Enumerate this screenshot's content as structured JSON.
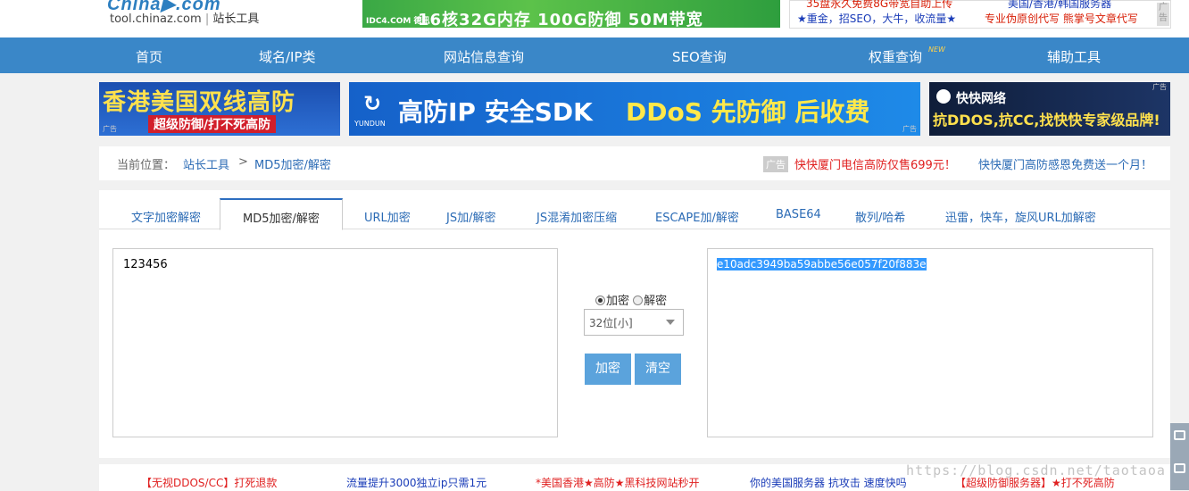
{
  "header": {
    "logo_text": "China▶.com",
    "site_url": "tool.chinaz.com",
    "site_name": "站长工具",
    "banner_brand": "IDC4.COM 德讯",
    "banner_text": "16核32G内存 100G防御 50M带宽",
    "ad_links": [
      "35盘永久免费8G带宽自助上传",
      "美国/香港/韩国服务器",
      "★重金，招SEO，大牛，收流量★",
      "专业伪原创代写 熊掌号文章代写"
    ],
    "ad_tag": "广告"
  },
  "nav": {
    "items": [
      "首页",
      "域名/IP类",
      "网站信息查询",
      "SEO查询",
      "权重查询",
      "辅助工具"
    ],
    "new_badge": "NEW"
  },
  "ads": {
    "left_title": "香港美国双线高防",
    "left_sub": "超级防御/打不死高防",
    "center_logo": "YUNDUN",
    "center_text1": "高防IP 安全SDK",
    "center_text2": "DDoS 先防御 后收费",
    "right_brand": "快快网络",
    "right_text": "抗DDOS,抗CC,找快快专家级品牌!",
    "ad_mark": "广告"
  },
  "breadcrumb": {
    "prefix": "当前位置：",
    "home": "站长工具",
    "sep": ">",
    "current": "MD5加密/解密",
    "ad_tag": "广告",
    "promo1": "快快厦门电信高防仅售699元！",
    "promo2": "快快厦门高防感恩免费送一个月！"
  },
  "tabs": [
    "文字加密解密",
    "MD5加密/解密",
    "URL加密",
    "JS加/解密",
    "JS混淆加密压缩",
    "ESCAPE加/解密",
    "BASE64",
    "散列/哈希",
    "迅雷，快车，旋风URL加解密"
  ],
  "tool": {
    "input_value": "123456",
    "output_value": "e10adc3949ba59abbe56e057f20f883e",
    "radio_encrypt": "加密",
    "radio_decrypt": "解密",
    "mode_selected": "32位[小]",
    "encrypt_button": "加密",
    "clear_button": "清空"
  },
  "footer_links": [
    "【无视DDOS/CC】打死退款",
    "流量提升3000独立ip只需1元",
    "*美国香港★高防★黑科技网站秒开",
    "你的美国服务器 抗攻击 速度快吗",
    "【超级防御服务器】★打不死高防"
  ],
  "watermark": "https://blog.csdn.net/taotaoa",
  "colors": {
    "nav_bg": "#3a87c8",
    "link_blue": "#2b6bb5",
    "promo_red": "#e02020",
    "button_blue": "#5ba3dc"
  }
}
